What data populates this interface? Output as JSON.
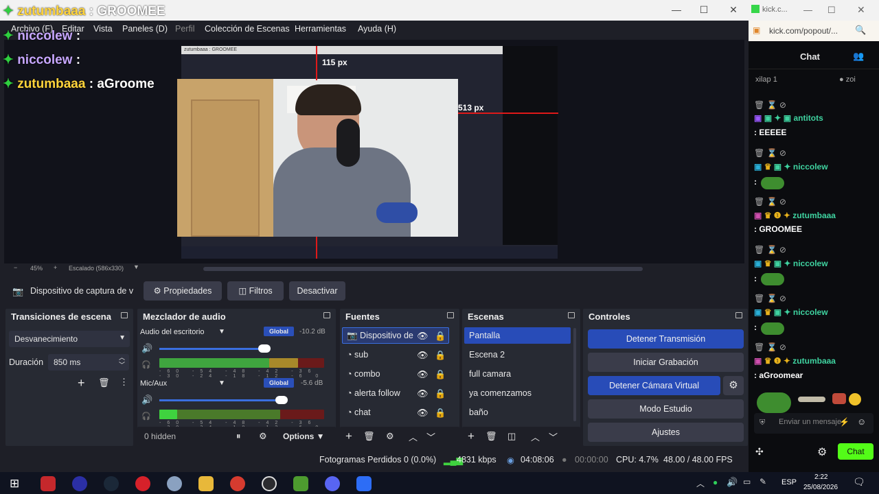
{
  "window": {
    "controls": [
      "—",
      "☐",
      "✕"
    ]
  },
  "menu": [
    "Archivo (F)",
    "Editar",
    "Vista",
    "Paneles (D)",
    "Perfil",
    "Colección de Escenas",
    "Herramientas",
    "Ayuda (H)"
  ],
  "overlay_chat": [
    {
      "user": "zutumbaaa",
      "text": ": GROOMEE"
    },
    {
      "user": "niccolew",
      "text": ":"
    },
    {
      "user": "niccolew",
      "text": ":"
    },
    {
      "user": "zutumbaaa",
      "text": ": aGroome"
    }
  ],
  "preview": {
    "inner_title": "zutumbaaa : GROOMEE",
    "measure_top": "115 px",
    "measure_right": "513 px"
  },
  "zoom": {
    "minus": "−",
    "percent": "45%",
    "plus": "+",
    "scale": "Escalado (586x330)"
  },
  "source_bar": {
    "source_name": "Dispositivo de captura de v",
    "props": "Propiedades",
    "filters": "Filtros",
    "deactivate": "Desactivar"
  },
  "transitions": {
    "title": "Transiciones de escena",
    "type": "Desvanecimiento",
    "duration_label": "Duración",
    "duration": "850 ms"
  },
  "mixer": {
    "title": "Mezclador de audio",
    "channels": [
      {
        "name": "Audio del escritorio",
        "tag": "Global",
        "db": "-10.2 dB",
        "level": 0.64
      },
      {
        "name": "Mic/Aux",
        "tag": "Global",
        "db": "-5.6 dB",
        "level": 0.74
      }
    ],
    "scale": "-60 -54 -48 -42 -36 -30 -24 -18 -12 -6 0",
    "hidden": "0 hidden",
    "options": "Options"
  },
  "sources": {
    "title": "Fuentes",
    "items": [
      "Dispositivo de",
      "sub",
      "combo",
      "alerta follow",
      "chat"
    ]
  },
  "scenes": {
    "title": "Escenas",
    "items": [
      "Pantalla",
      "Escena 2",
      "full camara",
      "ya comenzamos",
      "baño"
    ]
  },
  "controls": {
    "title": "Controles",
    "buttons": [
      "Detener Transmisión",
      "Iniciar Grabación",
      "Detener Cámara Virtual",
      "Modo Estudio",
      "Ajustes"
    ]
  },
  "status": {
    "dropped": "Fotogramas Perdidos 0 (0.0%)",
    "kbps": "4831 kbps",
    "live_time": "04:08:06",
    "rec_time": "00:00:00",
    "cpu": "CPU: 4.7%",
    "fps": "48.00 / 48.00 FPS"
  },
  "browser": {
    "title": "kick.c...",
    "url": "kick.com/popout/...",
    "chat_title": "Chat",
    "top_user": "xilap",
    "top_count": "1",
    "top_user2": "zoi"
  },
  "kick_chat": [
    {
      "user": "antitots",
      "text": ": EEEEE",
      "color": "#3fd3a0"
    },
    {
      "user": "niccolew",
      "text": ":",
      "color": "#3fd3a0"
    },
    {
      "user": "zutumbaaa",
      "text": ": GROOMEE",
      "color": "#3fd3a0"
    },
    {
      "user": "niccolew",
      "text": ":",
      "color": "#3fd3a0"
    },
    {
      "user": "niccolew",
      "text": ":",
      "color": "#3fd3a0"
    },
    {
      "user": "zutumbaaa",
      "text": ": aGroomear",
      "color": "#3fd3a0"
    }
  ],
  "chat_input": {
    "placeholder": "Enviar un mensaje",
    "send": "Chat"
  },
  "taskbar": {
    "lang": "ESP",
    "time": "2:22",
    "date": "25/08/2026"
  }
}
